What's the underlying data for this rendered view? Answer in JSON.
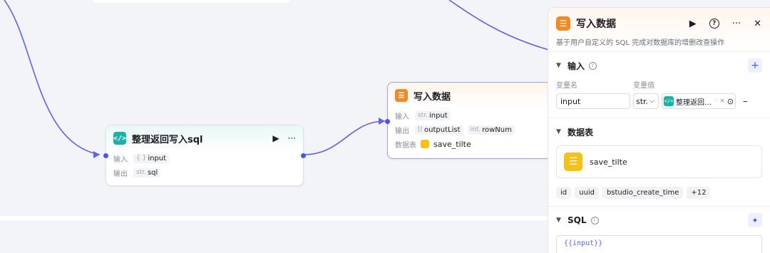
{
  "nodes": {
    "sql_node": {
      "title": "整理返回写入sql",
      "input_label": "输入",
      "input_type": "{ }",
      "input_name": "input",
      "output_label": "输出",
      "output_type": "str.",
      "output_name": "sql"
    },
    "db_node": {
      "title": "写入数据",
      "input_label": "输入",
      "input_type": "str.",
      "input_name": "input",
      "output_label": "输出",
      "output1_type": "[(",
      "output1_name": "outputList",
      "output2_type": "int.",
      "output2_name": "rowNum",
      "table_label": "数据表",
      "table_name": "save_tilte"
    }
  },
  "panel": {
    "title": "写入数据",
    "description": "基于用户自定义的 SQL 完成对数据库的增删改查操作",
    "input_section": {
      "title": "输入",
      "col_name": "变量名",
      "col_value": "变量值",
      "var_name": "input",
      "var_type": "str.",
      "var_ref": "整理返回…",
      "remove_label": "–"
    },
    "table_section": {
      "title": "数据表",
      "table_name": "save_tilte",
      "columns": [
        "id",
        "uuid",
        "bstudio_create_time",
        "+12"
      ]
    },
    "sql_section": {
      "title": "SQL",
      "sql_text": "{{input}}"
    }
  },
  "colors": {
    "edge": "#6063f2",
    "accent": "#4c54f0",
    "code_icon": "#19b4a5",
    "db_icon": "#f08a24"
  }
}
